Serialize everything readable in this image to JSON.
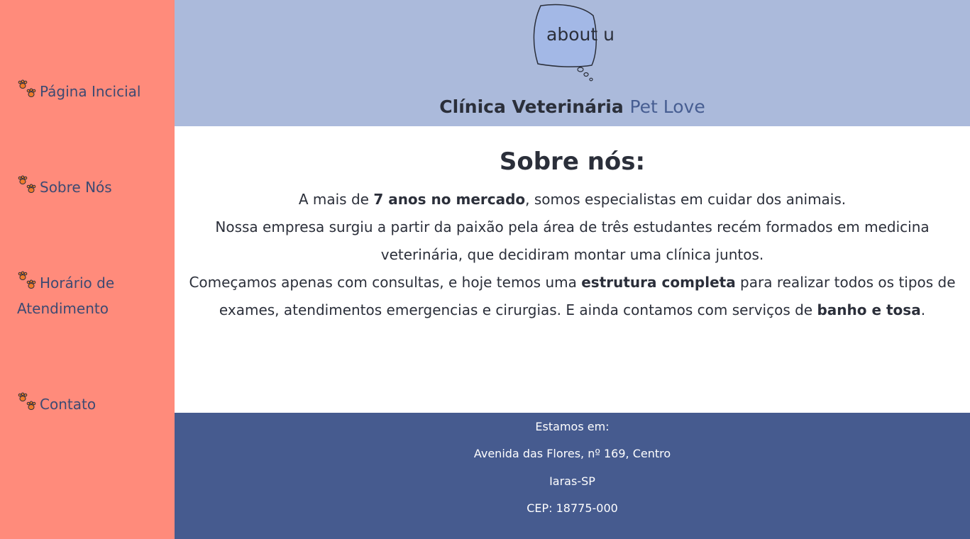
{
  "sidebar": {
    "items": [
      {
        "label": "Página Incicial",
        "icon": "paw-icon"
      },
      {
        "label": "Sobre Nós",
        "icon": "paw-icon"
      },
      {
        "label": "Horário de Atendimento",
        "icon": "paw-icon"
      },
      {
        "label": "Contato",
        "icon": "paw-icon"
      }
    ]
  },
  "header": {
    "logo_text": "about u",
    "title_main": "Clínica Veterinária",
    "title_accent": "Pet Love"
  },
  "main": {
    "heading": "Sobre nós:",
    "p1_a": "A mais de ",
    "p1_b": "7 anos no mercado",
    "p1_c": ", somos especialistas em cuidar dos animais.",
    "p2": "Nossa empresa surgiu a partir da paixão pela área de três estudantes recém formados em medicina veterinária, que decidiram montar uma clínica juntos.",
    "p3_a": "Começamos apenas com consultas, e hoje temos uma ",
    "p3_b": "estrutura completa",
    "p3_c": " para realizar todos os tipos de exames, atendimentos emergencias e cirurgias. E ainda contamos com serviços de ",
    "p3_d": "banho e tosa",
    "p3_e": "."
  },
  "footer": {
    "line1": "Estamos em:",
    "line2": "Avenida das Flores, nº 169, Centro",
    "line3": "Iaras-SP",
    "line4": "CEP: 18775-000"
  },
  "colors": {
    "sidebar_bg": "#ff8b7b",
    "header_bg": "#abbadb",
    "footer_bg": "#465b8f",
    "accent": "#475e92"
  }
}
